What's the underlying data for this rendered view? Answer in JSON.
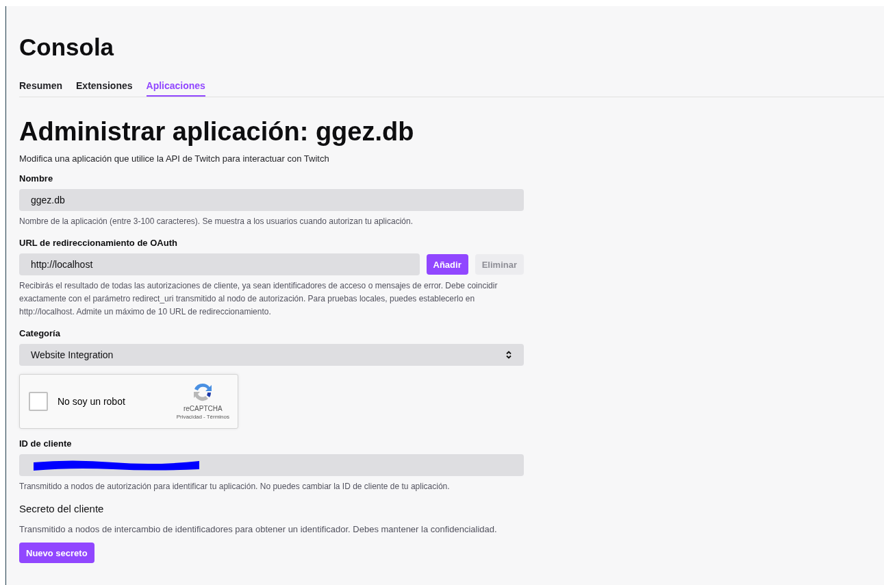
{
  "page_title": "Consola",
  "tabs": [
    {
      "label": "Resumen",
      "selected": false
    },
    {
      "label": "Extensiones",
      "selected": false
    },
    {
      "label": "Aplicaciones",
      "selected": true
    }
  ],
  "heading": "Administrar aplicación: ggez.db",
  "subtitle": "Modifica una aplicación que utilice la API de Twitch para interactuar con Twitch",
  "name_field": {
    "label": "Nombre",
    "value": "ggez.db",
    "help": "Nombre de la aplicación (entre 3-100 caracteres). Se muestra a los usuarios cuando autorizan tu aplicación."
  },
  "redirect_field": {
    "label": "URL de redireccionamiento de OAuth",
    "value": "http://localhost",
    "add_button": {
      "label": "Añadir",
      "disabled": false
    },
    "remove_button": {
      "label": "Eliminar",
      "disabled": true
    },
    "help": "Recibirás el resultado de todas las autorizaciones de cliente, ya sean identificadores de acceso o mensajes de error. Debe coincidir exactamente con el parámetro redirect_uri transmitido al nodo de autorización. Para pruebas locales, puedes establecerlo en http://localhost. Admite un máximo de 10 URL de redireccionamiento."
  },
  "category_field": {
    "label": "Categoría",
    "value": "Website Integration"
  },
  "captcha": {
    "label": "No soy un robot",
    "checked": false,
    "brand": "reCAPTCHA",
    "privacy": "Privacidad",
    "separator": "-",
    "terms": "Términos"
  },
  "client_id_field": {
    "label": "ID de cliente",
    "redacted": true,
    "help": "Transmitido a nodos de autorización para identificar tu aplicación. No puedes cambiar la ID de cliente de tu aplicación."
  },
  "client_secret": {
    "label": "Secreto del cliente",
    "help": "Transmitido a nodos de intercambio de identificadores para obtener un identificador. Debes mantener la confidencialidad.",
    "button": "Nuevo secreto"
  }
}
